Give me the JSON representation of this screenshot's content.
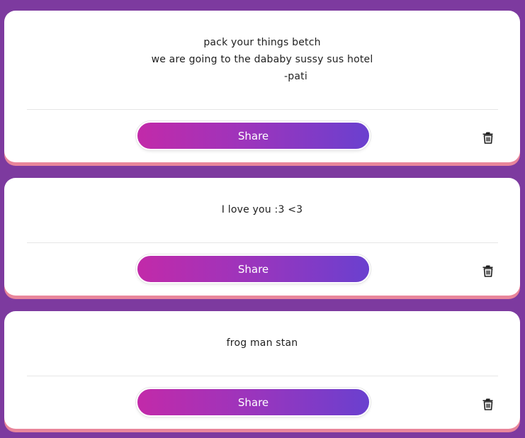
{
  "cards": [
    {
      "quote_lines": [
        "pack your things betch",
        "we are going to the dababy sussy sus hotel",
        "-pati"
      ],
      "share_label": "Share",
      "delete_icon": "trash-icon"
    },
    {
      "quote_lines": [
        "I love you :3 <3"
      ],
      "share_label": "Share",
      "delete_icon": "trash-icon"
    },
    {
      "quote_lines": [
        "frog man stan"
      ],
      "share_label": "Share",
      "delete_icon": "trash-icon"
    }
  ],
  "colors": {
    "background": "#7d3a9f",
    "card": "#ffffff",
    "card_shadow": "#e9869b",
    "button_gradient_start": "#c22aa9",
    "button_gradient_end": "#6a40cf"
  }
}
